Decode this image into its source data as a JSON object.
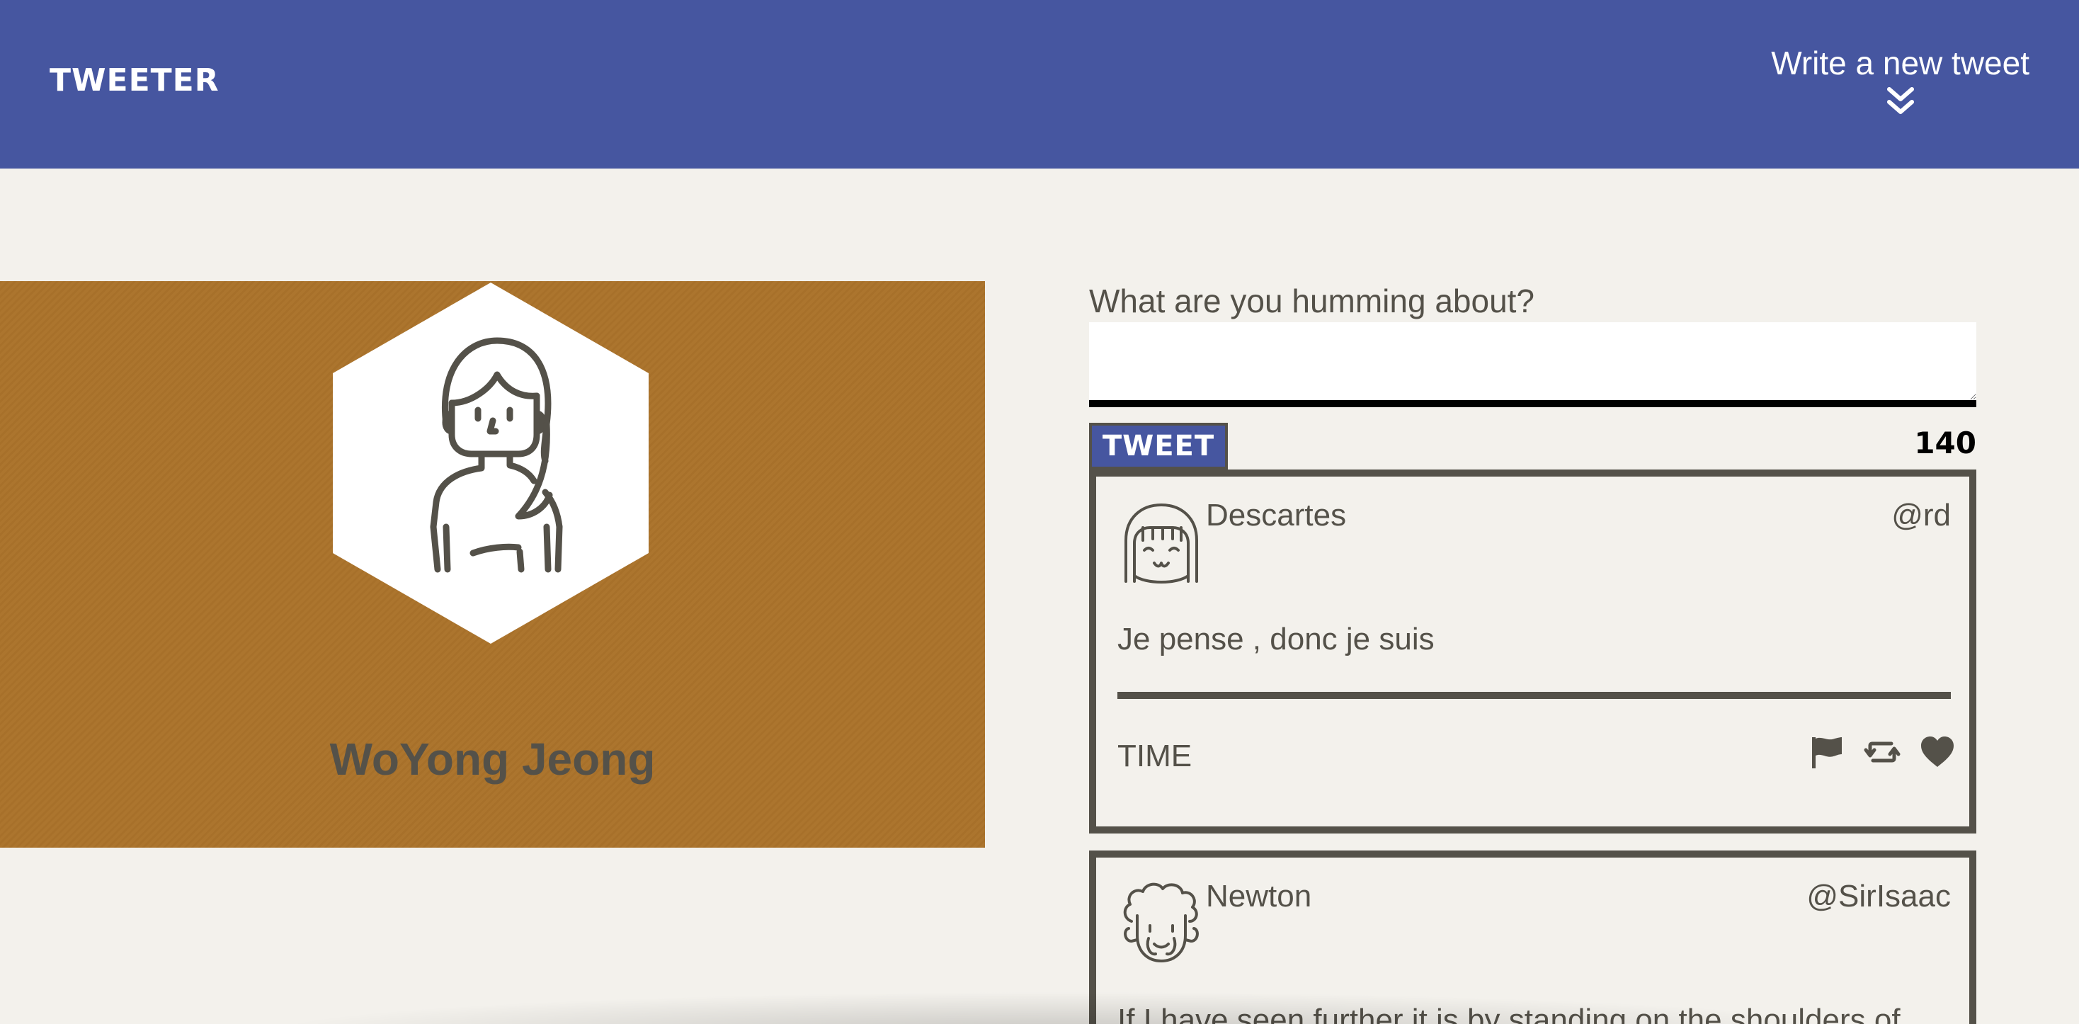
{
  "nav": {
    "brand": "TWEETER",
    "compose_toggle_label": "Write a new tweet",
    "compose_toggle_icon": "double-chevron-down-icon"
  },
  "profile": {
    "name": "WoYong Jeong",
    "avatar_icon": "person-avatar-icon",
    "banner_color": "#ab732b"
  },
  "compose": {
    "prompt": "What are you humming about?",
    "textarea_value": "",
    "tweet_button_label": "TWEET",
    "char_counter": "140"
  },
  "tweets": [
    {
      "name": "Descartes",
      "handle": "@rd",
      "body": "Je pense , donc je suis",
      "time": "TIME",
      "avatar_icon": "girl-avatar-icon",
      "actions": [
        "flag-icon",
        "retweet-icon",
        "heart-icon"
      ]
    },
    {
      "name": "Newton",
      "handle": "@SirIsaac",
      "body": "If I have seen further it is by standing on the shoulders of",
      "avatar_icon": "curly-hair-avatar-icon"
    }
  ],
  "colors": {
    "nav_background": "#4656a0",
    "page_background": "#f3f1ec",
    "text": "#545149"
  }
}
